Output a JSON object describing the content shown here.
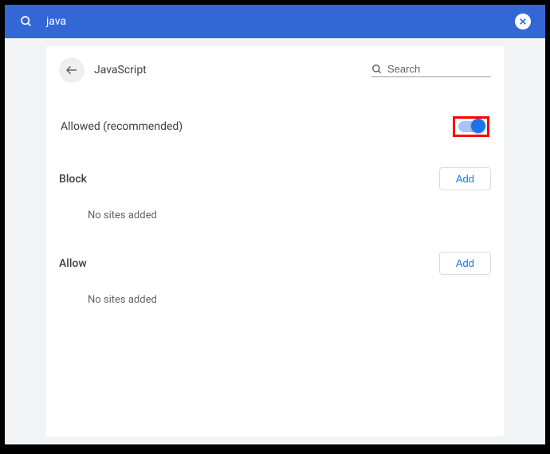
{
  "topbar": {
    "query": "java"
  },
  "page": {
    "title": "JavaScript",
    "search_placeholder": "Search"
  },
  "setting": {
    "allowed_label": "Allowed (recommended)",
    "toggle_on": true
  },
  "sections": {
    "block": {
      "title": "Block",
      "add_label": "Add",
      "empty": "No sites added"
    },
    "allow": {
      "title": "Allow",
      "add_label": "Add",
      "empty": "No sites added"
    }
  }
}
